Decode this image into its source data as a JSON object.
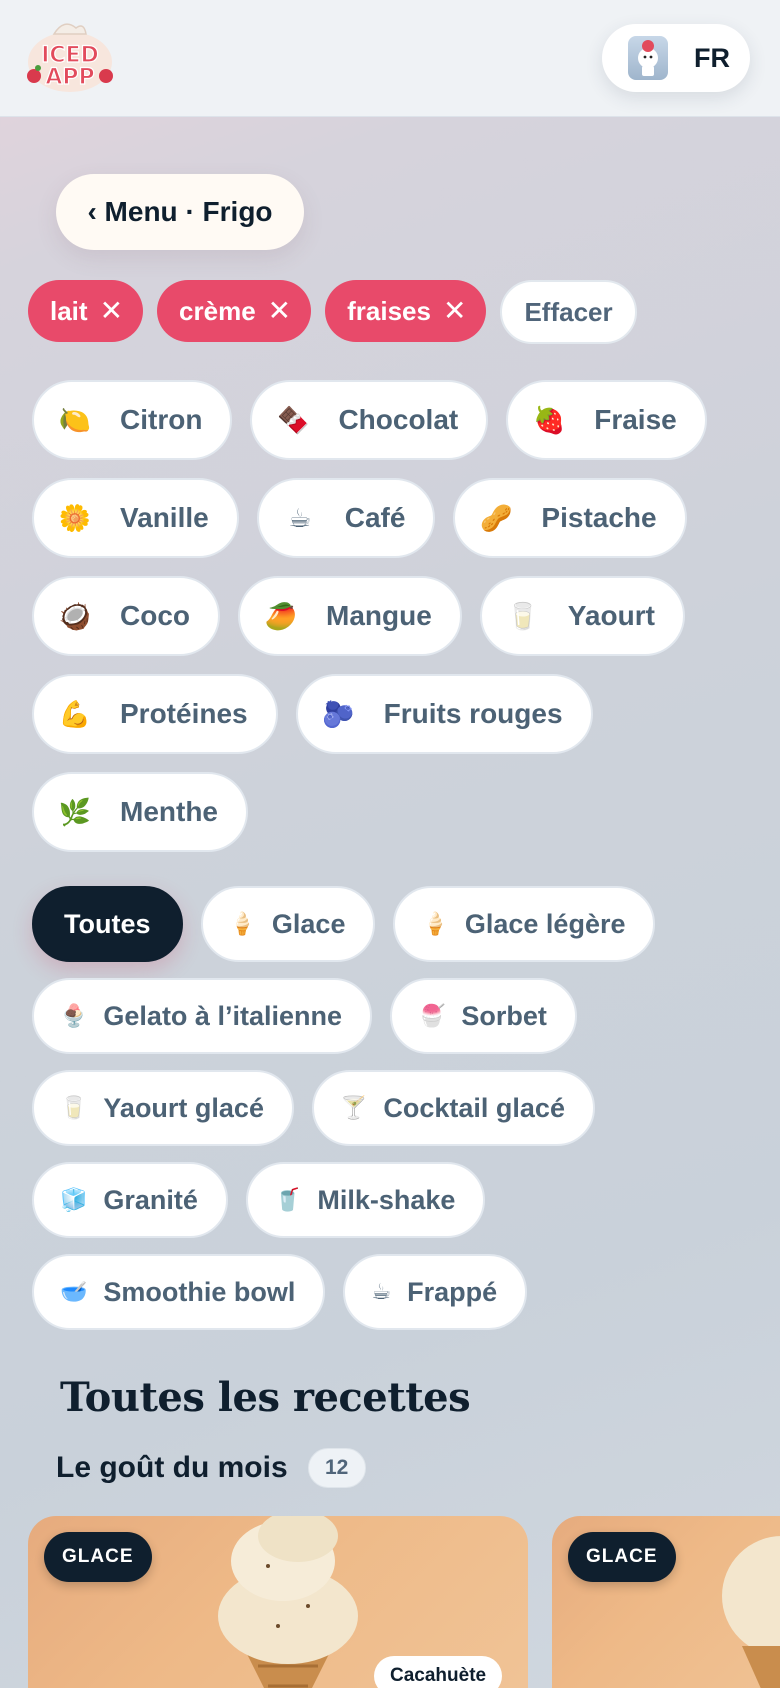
{
  "header": {
    "logo_text": "ICED APP",
    "lang_label": "FR"
  },
  "nav": {
    "back_label": "‹ Menu · Frigo"
  },
  "selected_filters": [
    {
      "label": "lait"
    },
    {
      "label": "crème"
    },
    {
      "label": "fraises"
    }
  ],
  "clear_label": "Effacer",
  "ingredients": [
    {
      "emoji": "🍋",
      "label": "Citron"
    },
    {
      "emoji": "🍫",
      "label": "Chocolat"
    },
    {
      "emoji": "🍓",
      "label": "Fraise"
    },
    {
      "emoji": "🌼",
      "label": "Vanille"
    },
    {
      "emoji": "☕",
      "label": "Café"
    },
    {
      "emoji": "🥜",
      "label": "Pistache"
    },
    {
      "emoji": "🥥",
      "label": "Coco"
    },
    {
      "emoji": "🥭",
      "label": "Mangue"
    },
    {
      "emoji": "🥛",
      "label": "Yaourt"
    },
    {
      "emoji": "💪",
      "label": "Protéines"
    },
    {
      "emoji": "🫐",
      "label": "Fruits rouges"
    },
    {
      "emoji": "🌿",
      "label": "Menthe"
    }
  ],
  "categories": [
    {
      "emoji": "",
      "label": "Toutes",
      "active": true
    },
    {
      "emoji": "🍦",
      "label": "Glace"
    },
    {
      "emoji": "🍦",
      "label": "Glace légère"
    },
    {
      "emoji": "🍨",
      "label": "Gelato à l’italienne"
    },
    {
      "emoji": "🍧",
      "label": "Sorbet"
    },
    {
      "emoji": "🥛",
      "label": "Yaourt glacé"
    },
    {
      "emoji": "🍸",
      "label": "Cocktail glacé"
    },
    {
      "emoji": "🧊",
      "label": "Granité"
    },
    {
      "emoji": "🥤",
      "label": "Milk-shake"
    },
    {
      "emoji": "🥣",
      "label": "Smoothie bowl"
    },
    {
      "emoji": "☕",
      "label": "Frappé"
    }
  ],
  "recipes": {
    "title": "Toutes les recettes",
    "subtitle": "Le goût du mois",
    "count": "12",
    "cards": [
      {
        "tag": "GLACE",
        "flavor": "Cacahuète"
      },
      {
        "tag": "GLACE",
        "flavor": ""
      }
    ]
  },
  "colors": {
    "accent": "#e84a6a",
    "dark": "#0f1f2e",
    "chip_text": "#4c6275"
  }
}
